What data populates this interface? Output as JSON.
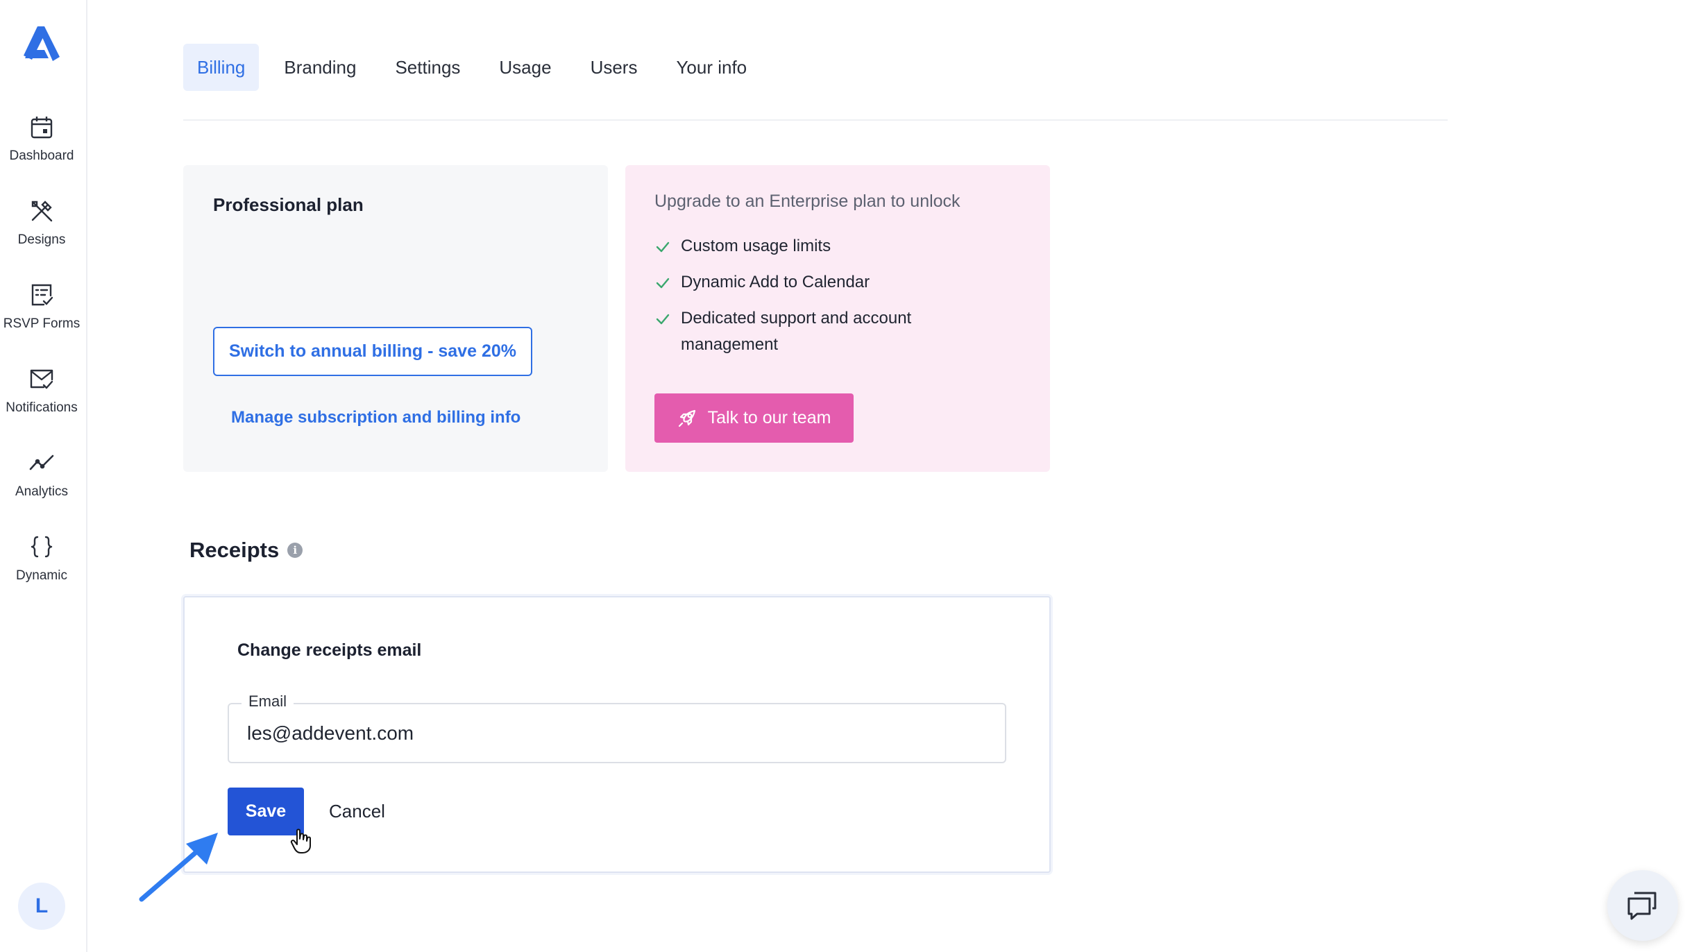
{
  "sidebar": {
    "logo": "addevent-logo-icon",
    "items": [
      {
        "label": "Dashboard",
        "icon": "calendar-icon"
      },
      {
        "label": "Designs",
        "icon": "design-tools-icon"
      },
      {
        "label": "RSVP Forms",
        "icon": "form-check-icon"
      },
      {
        "label": "Notifications",
        "icon": "mail-check-icon"
      },
      {
        "label": "Analytics",
        "icon": "trend-line-icon"
      },
      {
        "label": "Dynamic",
        "icon": "braces-icon"
      }
    ],
    "avatar_initial": "L"
  },
  "tabs": [
    {
      "label": "Billing",
      "active": true
    },
    {
      "label": "Branding",
      "active": false
    },
    {
      "label": "Settings",
      "active": false
    },
    {
      "label": "Usage",
      "active": false
    },
    {
      "label": "Users",
      "active": false
    },
    {
      "label": "Your info",
      "active": false
    }
  ],
  "plan": {
    "title": "Professional plan",
    "annual_button": "Switch to annual billing - save 20%",
    "manage_link": "Manage subscription and billing info"
  },
  "upgrade": {
    "title": "Upgrade to an Enterprise plan to unlock",
    "features": [
      "Custom usage limits",
      "Dynamic Add to Calendar",
      "Dedicated support and account management"
    ],
    "cta": "Talk to our team"
  },
  "receipts": {
    "heading": "Receipts",
    "info_icon": "i",
    "card_title": "Change receipts email",
    "email_label": "Email",
    "email_value": "les@addevent.com",
    "save_label": "Save",
    "cancel_label": "Cancel"
  },
  "colors": {
    "primary": "#2f6fe4",
    "save": "#2354d6",
    "pink": "#e45cae",
    "pink_bg": "#fcebf5",
    "check": "#3aa76d"
  }
}
